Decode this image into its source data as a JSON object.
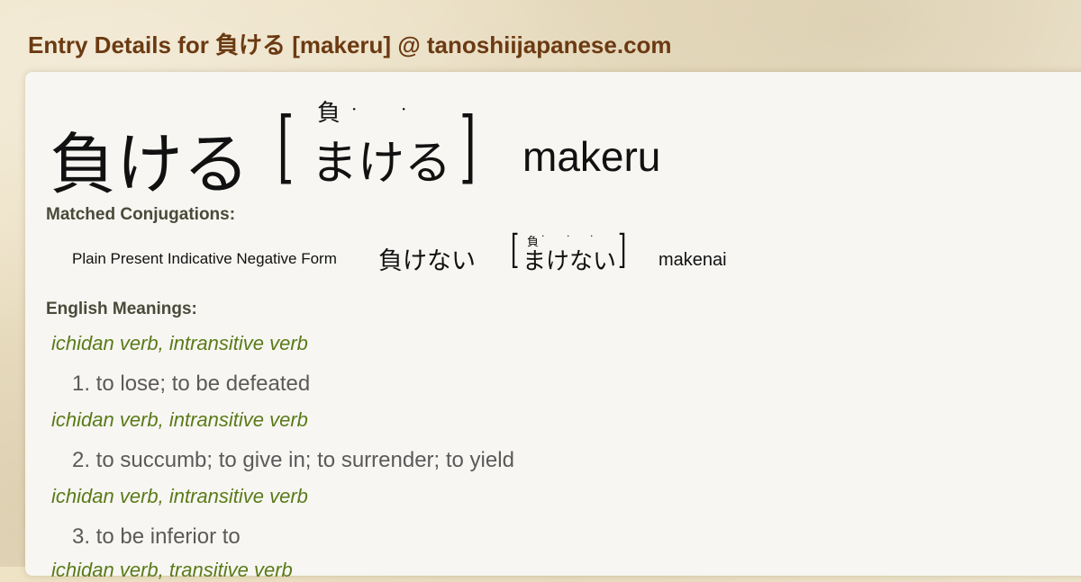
{
  "page_title": "Entry Details for 負ける [makeru] @ tanoshiijapanese.com",
  "entry": {
    "kanji": "負ける",
    "furigana_kanji": "負",
    "kana": "まける",
    "romaji": "makeru",
    "bracket_open": "[",
    "bracket_close": "]",
    "dot": "·"
  },
  "matched_conjugations": {
    "label": "Matched Conjugations:",
    "items": [
      {
        "form": "Plain Present Indicative Negative Form",
        "kanji": "負けない",
        "furigana_kanji": "負",
        "kana": "まけない",
        "romaji": "makenai"
      }
    ]
  },
  "english_meanings": {
    "label": "English Meanings:",
    "items": [
      {
        "pos": "ichidan verb, intransitive verb",
        "meaning": "1. to lose; to be defeated"
      },
      {
        "pos": "ichidan verb, intransitive verb",
        "meaning": "2. to succumb; to give in; to surrender; to yield"
      },
      {
        "pos": "ichidan verb, intransitive verb",
        "meaning": "3. to be inferior to"
      },
      {
        "pos": "ichidan verb, transitive verb"
      }
    ]
  }
}
